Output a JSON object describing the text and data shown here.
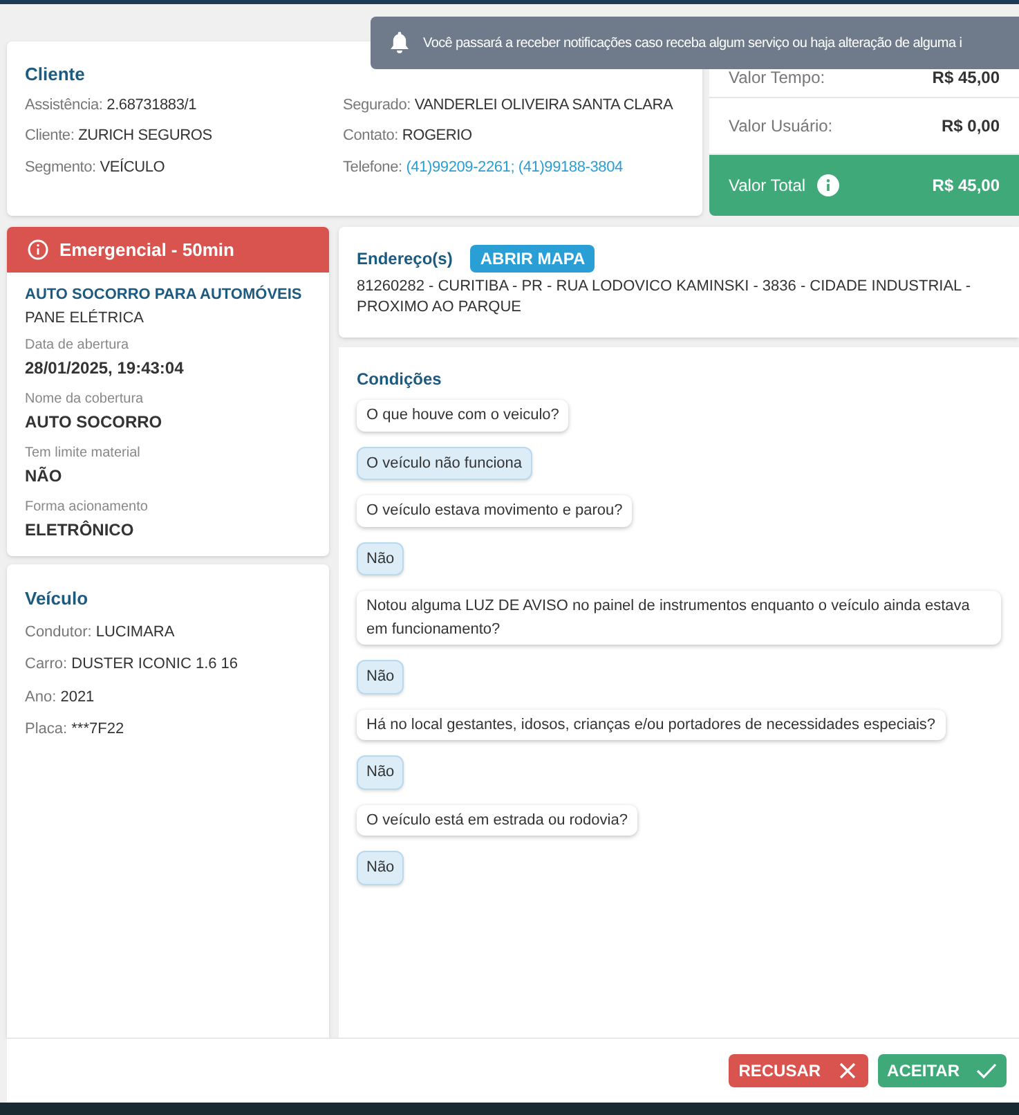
{
  "toast": {
    "text": "Você passará a receber notificações caso receba algum serviço ou haja alteração de alguma i"
  },
  "cliente": {
    "title": "Cliente",
    "fields": [
      {
        "label": "Assistência:",
        "value": "2.68731883/1"
      },
      {
        "label": "Segurado:",
        "value": "VANDERLEI OLIVEIRA SANTA CLARA"
      },
      {
        "label": "Cliente:",
        "value": "ZURICH SEGUROS"
      },
      {
        "label": "Contato:",
        "value": "ROGERIO"
      },
      {
        "label": "Segmento:",
        "value": "VEÍCULO"
      },
      {
        "label": "Telefone:",
        "value": "(41)99209-2261; (41)99188-3804",
        "kind": "link"
      }
    ]
  },
  "valores": [
    {
      "label": "Valor Tempo:",
      "value": "R$ 45,00",
      "kind": "plain"
    },
    {
      "label": "Valor Usuário:",
      "value": "R$ 0,00",
      "kind": "plain"
    },
    {
      "label": "Valor Total",
      "value": "R$ 45,00",
      "kind": "total"
    }
  ],
  "servico": {
    "badge": "Emergencial - 50min",
    "title": "AUTO SOCORRO PARA AUTOMÓVEIS",
    "subtitle": "PANE ELÉTRICA",
    "details": [
      {
        "label": "Data de abertura",
        "value": "28/01/2025, 19:43:04"
      },
      {
        "label": "Nome da cobertura",
        "value": "AUTO SOCORRO"
      },
      {
        "label": "Tem limite material",
        "value": "NÃO"
      },
      {
        "label": "Forma acionamento",
        "value": "ELETRÔNICO"
      }
    ]
  },
  "veiculo": {
    "title": "Veículo",
    "fields": [
      {
        "label": "Condutor:",
        "value": "LUCIMARA"
      },
      {
        "label": "Carro:",
        "value": "DUSTER ICONIC 1.6 16"
      },
      {
        "label": "Ano:",
        "value": "2021"
      },
      {
        "label": "Placa:",
        "value": "***7F22"
      }
    ]
  },
  "endereco": {
    "title": "Endereço(s)",
    "button": "ABRIR MAPA",
    "text": "81260282 - CURITIBA - PR - RUA LODOVICO KAMINSKI - 3836 - CIDADE INDUSTRIAL - PROXIMO AO PARQUE"
  },
  "condicoes": {
    "title": "Condições",
    "items": [
      {
        "kind": "question",
        "text": "O que houve com o veiculo?"
      },
      {
        "kind": "answer",
        "text": "O veículo não funciona"
      },
      {
        "kind": "question",
        "text": "O veículo estava movimento e parou?"
      },
      {
        "kind": "answer",
        "text": "Não"
      },
      {
        "kind": "question",
        "text": "Notou alguma LUZ DE AVISO no painel de instrumentos enquanto o veículo ainda estava em funcionamento?"
      },
      {
        "kind": "answer",
        "text": "Não"
      },
      {
        "kind": "question",
        "text": "Há no local gestantes, idosos, crianças e/ou portadores de necessidades especiais?"
      },
      {
        "kind": "answer",
        "text": "Não"
      },
      {
        "kind": "question",
        "text": "O veículo está em estrada ou rodovia?"
      },
      {
        "kind": "answer",
        "text": "Não"
      }
    ]
  },
  "actions": [
    {
      "kind": "refuse",
      "label": "RECUSAR"
    },
    {
      "kind": "accept",
      "label": "ACEITAR"
    }
  ]
}
